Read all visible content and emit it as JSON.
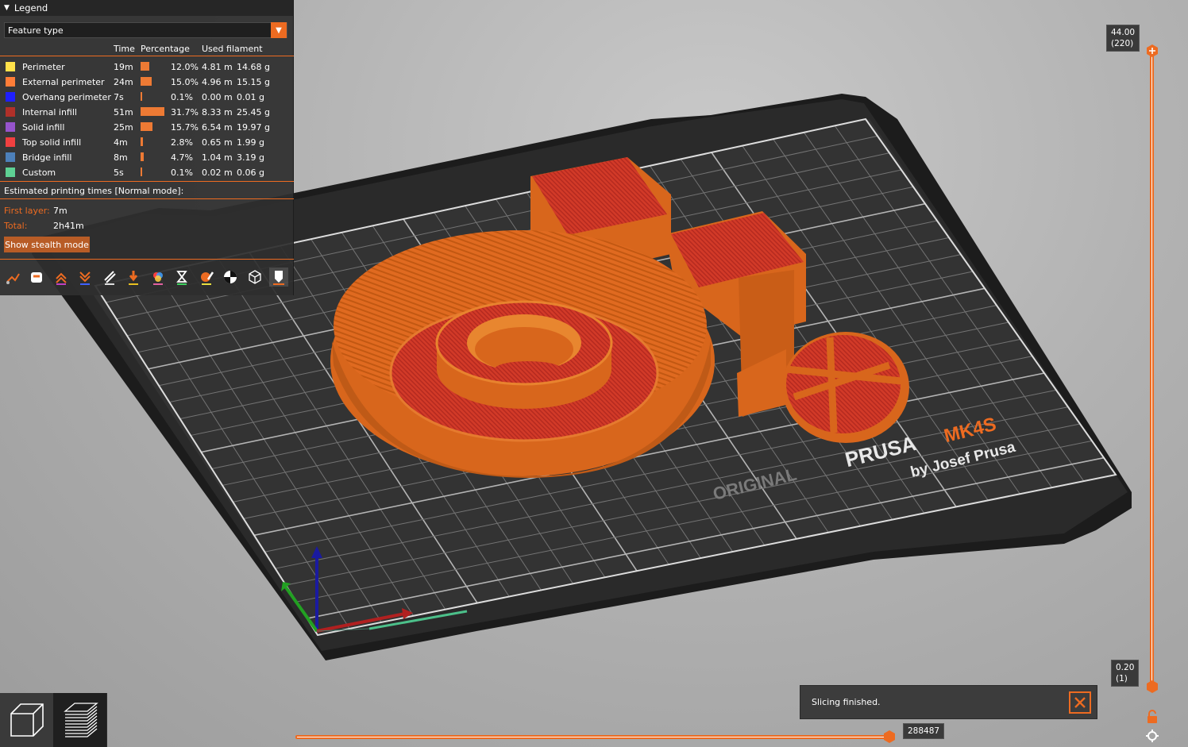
{
  "legend": {
    "title": "Legend",
    "view_type": "Feature type",
    "columns": {
      "time": "Time",
      "percentage": "Percentage",
      "used_filament": "Used filament"
    },
    "rows": [
      {
        "name": "Perimeter",
        "color": "#ffe14a",
        "time": "19m",
        "pct": "12.0%",
        "pct_value": 12.0,
        "length": "4.81 m",
        "weight": "14.68 g"
      },
      {
        "name": "External perimeter",
        "color": "#ff7d38",
        "time": "24m",
        "pct": "15.0%",
        "pct_value": 15.0,
        "length": "4.96 m",
        "weight": "15.15 g"
      },
      {
        "name": "Overhang perimeter",
        "color": "#1f1fff",
        "time": "7s",
        "pct": "0.1%",
        "pct_value": 0.1,
        "length": "0.00 m",
        "weight": "0.01 g"
      },
      {
        "name": "Internal infill",
        "color": "#b03029",
        "time": "51m",
        "pct": "31.7%",
        "pct_value": 31.7,
        "length": "8.33 m",
        "weight": "25.45 g"
      },
      {
        "name": "Solid infill",
        "color": "#9654cc",
        "time": "25m",
        "pct": "15.7%",
        "pct_value": 15.7,
        "length": "6.54 m",
        "weight": "19.97 g"
      },
      {
        "name": "Top solid infill",
        "color": "#f04040",
        "time": "4m",
        "pct": "2.8%",
        "pct_value": 2.8,
        "length": "0.65 m",
        "weight": "1.99 g"
      },
      {
        "name": "Bridge infill",
        "color": "#4d80ba",
        "time": "8m",
        "pct": "4.7%",
        "pct_value": 4.7,
        "length": "1.04 m",
        "weight": "3.19 g"
      },
      {
        "name": "Custom",
        "color": "#5ed194",
        "time": "5s",
        "pct": "0.1%",
        "pct_value": 0.1,
        "length": "0.02 m",
        "weight": "0.06 g"
      }
    ],
    "estimated_label": "Estimated printing times [Normal mode]:",
    "first_layer_label": "First layer:",
    "first_layer_value": "7m",
    "total_label": "Total:",
    "total_value": "2h41m",
    "stealth_button": "Show stealth mode",
    "toolbar_icons": [
      "travel-icon",
      "wipe-icon",
      "retractions-icon",
      "deretractions-icon",
      "seams-icon",
      "tool-changes-icon",
      "color-changes-icon",
      "pause-prints-icon",
      "custom-gcode-icon",
      "center-of-gravity-icon",
      "shells-icon",
      "tool-marker-icon"
    ]
  },
  "vertical_slider": {
    "top_value": "44.00",
    "top_layer": "(220)",
    "bottom_value": "0.20",
    "bottom_layer": "(1)",
    "accent": "#ed6b21"
  },
  "horizontal_slider": {
    "value": "288487",
    "fill_fraction": 1.0
  },
  "notification": {
    "text": "Slicing finished."
  },
  "bed": {
    "brand_line1_a": "ORIGINAL",
    "brand_line1_b": "PRUSA",
    "brand_line1_c": "MK4S",
    "brand_line2": "by Josef Prusa"
  },
  "views": [
    "3d-view-icon",
    "preview-layers-icon"
  ]
}
